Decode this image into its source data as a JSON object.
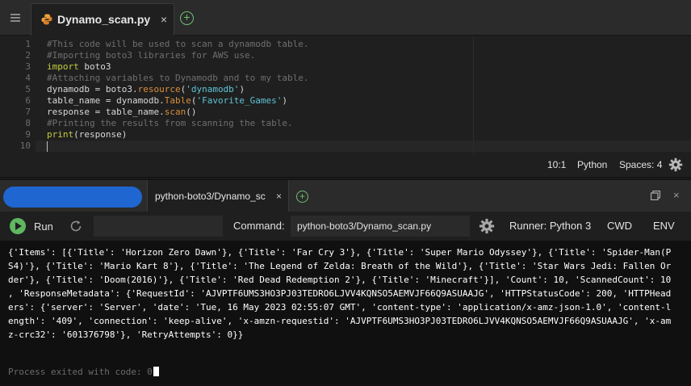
{
  "editor": {
    "tab": {
      "label": "Dynamo_scan.py",
      "close": "×"
    },
    "add_tab": "+",
    "lines": [
      {
        "num": "1",
        "tokens": [
          {
            "t": "#This code will be used to scan a dynamodb table.",
            "c": "tok-comment"
          }
        ]
      },
      {
        "num": "2",
        "tokens": [
          {
            "t": "#Importing boto3 libraries for AWS use.",
            "c": "tok-comment"
          }
        ]
      },
      {
        "num": "3",
        "tokens": [
          {
            "t": "import",
            "c": "tok-keyword"
          },
          {
            "t": " boto3",
            "c": "tok-plain"
          }
        ]
      },
      {
        "num": "4",
        "tokens": [
          {
            "t": "#Attaching variables to Dynamodb and to my table.",
            "c": "tok-comment"
          }
        ]
      },
      {
        "num": "5",
        "tokens": [
          {
            "t": "dynamodb = boto3.",
            "c": "tok-plain"
          },
          {
            "t": "resource",
            "c": "tok-func"
          },
          {
            "t": "(",
            "c": "tok-plain"
          },
          {
            "t": "'dynamodb'",
            "c": "tok-string"
          },
          {
            "t": ")",
            "c": "tok-plain"
          }
        ]
      },
      {
        "num": "6",
        "tokens": [
          {
            "t": "table_name = dynamodb.",
            "c": "tok-plain"
          },
          {
            "t": "Table",
            "c": "tok-func"
          },
          {
            "t": "(",
            "c": "tok-plain"
          },
          {
            "t": "'Favorite_Games'",
            "c": "tok-string"
          },
          {
            "t": ")",
            "c": "tok-plain"
          }
        ]
      },
      {
        "num": "7",
        "tokens": [
          {
            "t": "response = table_name.",
            "c": "tok-plain"
          },
          {
            "t": "scan",
            "c": "tok-func"
          },
          {
            "t": "()",
            "c": "tok-plain"
          }
        ]
      },
      {
        "num": "8",
        "tokens": [
          {
            "t": "#Printing the results from scanning the table.",
            "c": "tok-comment"
          }
        ]
      },
      {
        "num": "9",
        "tokens": [
          {
            "t": "print",
            "c": "tok-keyword"
          },
          {
            "t": "(response)",
            "c": "tok-plain"
          }
        ]
      },
      {
        "num": "10",
        "tokens": []
      }
    ],
    "status": {
      "position": "10:1",
      "language": "Python",
      "spaces": "Spaces: 4"
    }
  },
  "terminal": {
    "tab": {
      "label": "python-boto3/Dynamo_sc",
      "close": "×"
    },
    "add_tab": "+",
    "close": "×",
    "run_label": "Run",
    "args_value": "",
    "command_label": "Command:",
    "command_value": "python-boto3/Dynamo_scan.py",
    "runner": "Runner: Python 3",
    "cwd": "CWD",
    "env": "ENV",
    "output_lines": [
      "{'Items': [{'Title': 'Horizon Zero Dawn'}, {'Title': 'Far Cry 3'}, {'Title': 'Super Mario Odyssey'}, {'Title': 'Spider-Man(P",
      "S4)'}, {'Title': 'Mario Kart 8'}, {'Title': 'The Legend of Zelda: Breath of the Wild'}, {'Title': 'Star Wars Jedi: Fallen Or",
      "der'}, {'Title': 'Doom(2016)'}, {'Title': 'Red Dead Redemption 2'}, {'Title': 'Minecraft'}], 'Count': 10, 'ScannedCount': 10",
      ", 'ResponseMetadata': {'RequestId': 'AJVPTF6UMS3HO3PJ03TEDRO6LJVV4KQNSO5AEMVJF66Q9ASUAAJG', 'HTTPStatusCode': 200, 'HTTPHead",
      "ers': {'server': 'Server', 'date': 'Tue, 16 May 2023 02:55:07 GMT', 'content-type': 'application/x-amz-json-1.0', 'content-l",
      "ength': '409', 'connection': 'keep-alive', 'x-amzn-requestid': 'AJVPTF6UMS3HO3PJ03TEDRO6LJVV4KQNSO5AEMVJF66Q9ASUAAJG', 'x-am",
      "z-crc32': '601376798'}, 'RetryAttempts': 0}}"
    ],
    "exit_message": "Process exited with code: 0"
  }
}
